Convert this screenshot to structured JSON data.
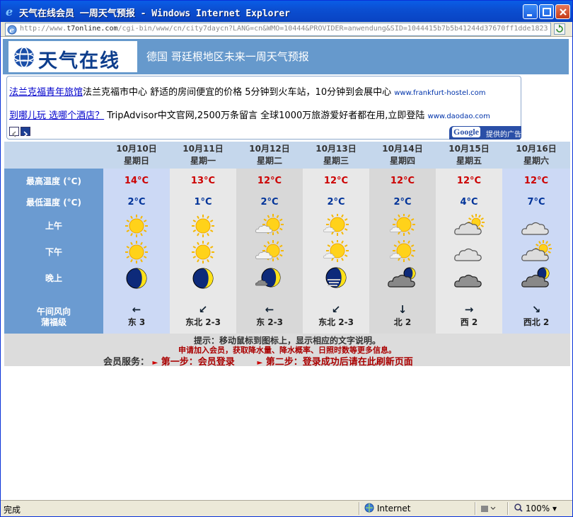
{
  "window": {
    "title": "天气在线会员 一周天气预报 - Windows Internet Explorer",
    "url_prefix": "http://www.",
    "url_domain": "t7online.com",
    "url_rest": "/cgi-bin/www/cn/city7daycn?LANG=cn&WMO=10444&PROVIDER=anwendung&SID=1044415b7b5b41244d37670ff1dde1823"
  },
  "header": {
    "logo_text": "天气在线",
    "title": "德国 哥廷根地区未来一周天气预报"
  },
  "ads": [
    {
      "link": "法兰克福青年旅馆",
      "text": "法兰克福市中心 舒适的房间便宜的价格 5分钟到火车站，10分钟到会展中心",
      "domain": "www.frankfurt-hostel.com"
    },
    {
      "link": "到哪儿玩 选哪个酒店？",
      "text": " TripAdvisor中文官网,2500万条留言 全球1000万旅游爱好者都在用,立即登陆",
      "domain": "www.daodao.com"
    }
  ],
  "google_badge": {
    "brand": "Google",
    "text": "提供的广告"
  },
  "labels": {
    "high": "最高温度 (°C)",
    "low": "最低温度 (°C)",
    "morning": "上午",
    "afternoon": "下午",
    "night": "晚上",
    "wind1": "午间风向",
    "wind2": "蒲福级"
  },
  "days": [
    {
      "date": "10月10日",
      "weekday": "星期日",
      "high": "14°C",
      "low": "2°C",
      "am": "sunny",
      "pm": "sunny",
      "night": "moon-clear",
      "wind_arrow": "←",
      "wind": "东 3"
    },
    {
      "date": "10月11日",
      "weekday": "星期一",
      "high": "13°C",
      "low": "1°C",
      "am": "sunny",
      "pm": "sunny",
      "night": "moon-clear",
      "wind_arrow": "↙",
      "wind": "东北 2-3"
    },
    {
      "date": "10月12日",
      "weekday": "星期二",
      "high": "12°C",
      "low": "2°C",
      "am": "sun-cloud",
      "pm": "sun-cloud",
      "night": "moon-cloud",
      "wind_arrow": "←",
      "wind": "东 2-3"
    },
    {
      "date": "10月13日",
      "weekday": "星期三",
      "high": "12°C",
      "low": "2°C",
      "am": "sun-cloud-small",
      "pm": "sun-cloud-small",
      "night": "moon-fog",
      "wind_arrow": "↙",
      "wind": "东北 2-3"
    },
    {
      "date": "10月14日",
      "weekday": "星期四",
      "high": "12°C",
      "low": "2°C",
      "am": "sun-cloud-small",
      "pm": "sun-cloud-small",
      "night": "cloud-moon-dark",
      "wind_arrow": "↓",
      "wind": "北 2"
    },
    {
      "date": "10月15日",
      "weekday": "星期五",
      "high": "12°C",
      "low": "4°C",
      "am": "cloud-sun",
      "pm": "cloud",
      "night": "cloud-dark",
      "wind_arrow": "→",
      "wind": "西 2"
    },
    {
      "date": "10月16日",
      "weekday": "星期六",
      "high": "12°C",
      "low": "7°C",
      "am": "cloud",
      "pm": "cloud-sun",
      "night": "cloud-moon-dark",
      "wind_arrow": "↘",
      "wind": "西北 2"
    }
  ],
  "column_colors": [
    "#ccd9f5",
    "#e8e8e8",
    "#d8d8d8",
    "#e8e8e8",
    "#d8d8d8",
    "#e8e8e8",
    "#ccd9f5"
  ],
  "notice": {
    "tip": "提示：移动鼠标到图标上，显示相应的文字说明。",
    "join": "申请加入会员，获取降水量、降水概率、日照时数等更多信息。",
    "service_label": "会员服务：",
    "step1": "第一步：会员登录",
    "step2": "第二步：登录成功后请在此刷新页面"
  },
  "status": {
    "text": "完成",
    "zone": "Internet",
    "zoom": "100%"
  }
}
